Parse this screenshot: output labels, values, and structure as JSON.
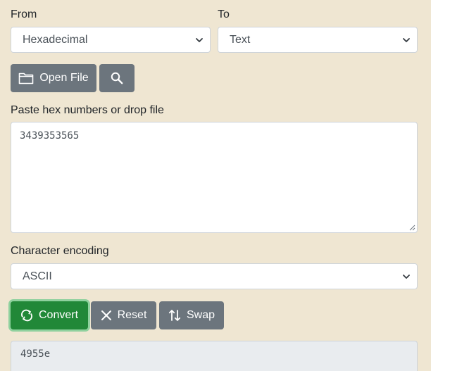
{
  "from": {
    "label": "From",
    "selected": "Hexadecimal"
  },
  "to": {
    "label": "To",
    "selected": "Text"
  },
  "toolbar": {
    "open_file_label": "Open File"
  },
  "input": {
    "label": "Paste hex numbers or drop file",
    "value": "3439353565"
  },
  "encoding": {
    "label": "Character encoding",
    "selected": "ASCII"
  },
  "actions": {
    "convert_label": "Convert",
    "reset_label": "Reset",
    "swap_label": "Swap"
  },
  "output": {
    "value": "4955e"
  },
  "colors": {
    "panel_bg": "#efe6d2",
    "button_gray": "#6c757d",
    "button_green": "#218838",
    "output_bg": "#e9ecef"
  },
  "icons": {
    "open_file": "folder-icon",
    "search": "search-icon",
    "convert": "refresh-icon",
    "reset": "close-icon",
    "swap": "swap-vertical-icon",
    "select": "chevron-down-icon"
  }
}
